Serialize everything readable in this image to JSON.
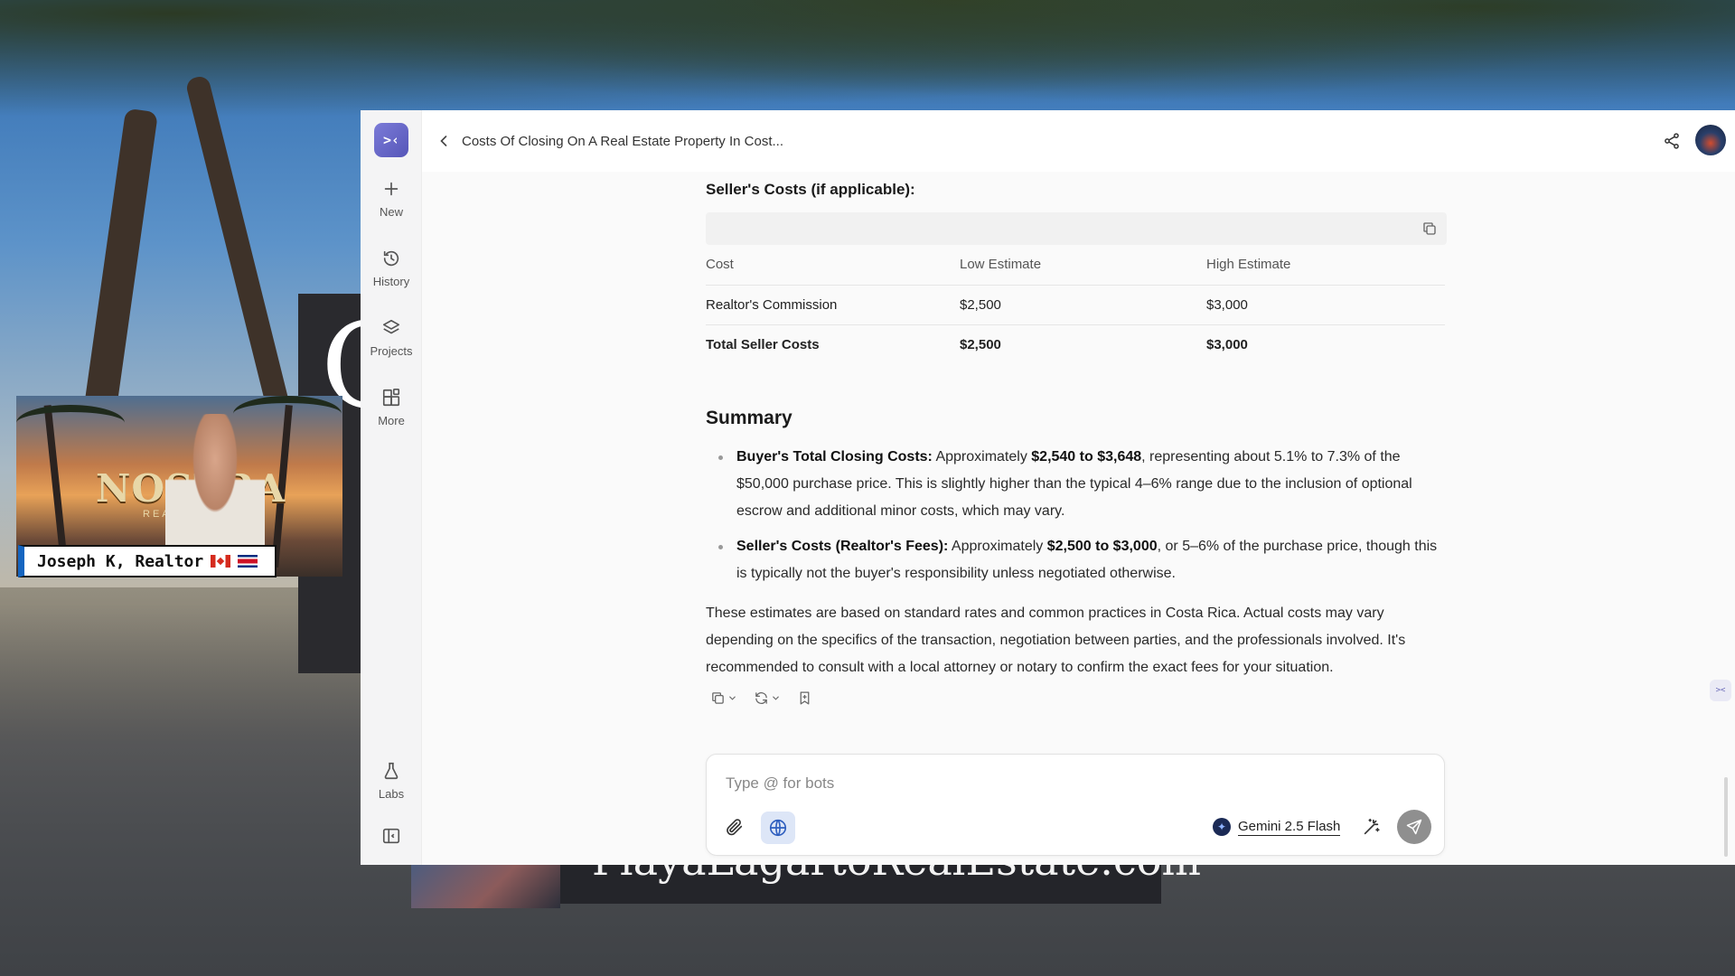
{
  "overlay": {
    "webcam_logo": "NOSTRA",
    "webcam_logo_sub": "REALTY GROUP",
    "name_tag": "Joseph K, Realtor",
    "big_letter": "C",
    "banner_text": "PlayaLagartoRealEstate.com"
  },
  "app": {
    "logo_text": ">‹",
    "rail": {
      "new": "New",
      "history": "History",
      "projects": "Projects",
      "more": "More",
      "labs": "Labs"
    },
    "conversation_title": "Costs Of Closing On A Real Estate Property In Cost..."
  },
  "content": {
    "seller_section_title": "Seller's Costs (if applicable):",
    "table": {
      "headers": [
        "Cost",
        "Low Estimate",
        "High Estimate"
      ],
      "rows": [
        [
          "Realtor's Commission",
          "$2,500",
          "$3,000"
        ],
        [
          "Total Seller Costs",
          "$2,500",
          "$3,000"
        ]
      ]
    },
    "summary_title": "Summary",
    "bullets": [
      {
        "label": "Buyer's Total Closing Costs:",
        "pre": " Approximately ",
        "bold": "$2,540 to $3,648",
        "post": ", representing about 5.1% to 7.3% of the $50,000 purchase price. This is slightly higher than the typical 4–6% range due to the inclusion of optional escrow and additional minor costs, which may vary."
      },
      {
        "label": "Seller's Costs (Realtor's Fees):",
        "pre": " Approximately ",
        "bold": "$2,500 to $3,000",
        "post": ", or 5–6% of the purchase price, though this is typically not the buyer's responsibility unless negotiated otherwise."
      }
    ],
    "closing_paragraph": "These estimates are based on standard rates and common practices in Costa Rica. Actual costs may vary depending on the specifics of the transaction, negotiation between parties, and the professionals involved. It's recommended to consult with a local attorney or notary to confirm the exact fees for your situation."
  },
  "composer": {
    "placeholder": "Type @ for bots",
    "model": "Gemini 2.5 Flash"
  }
}
